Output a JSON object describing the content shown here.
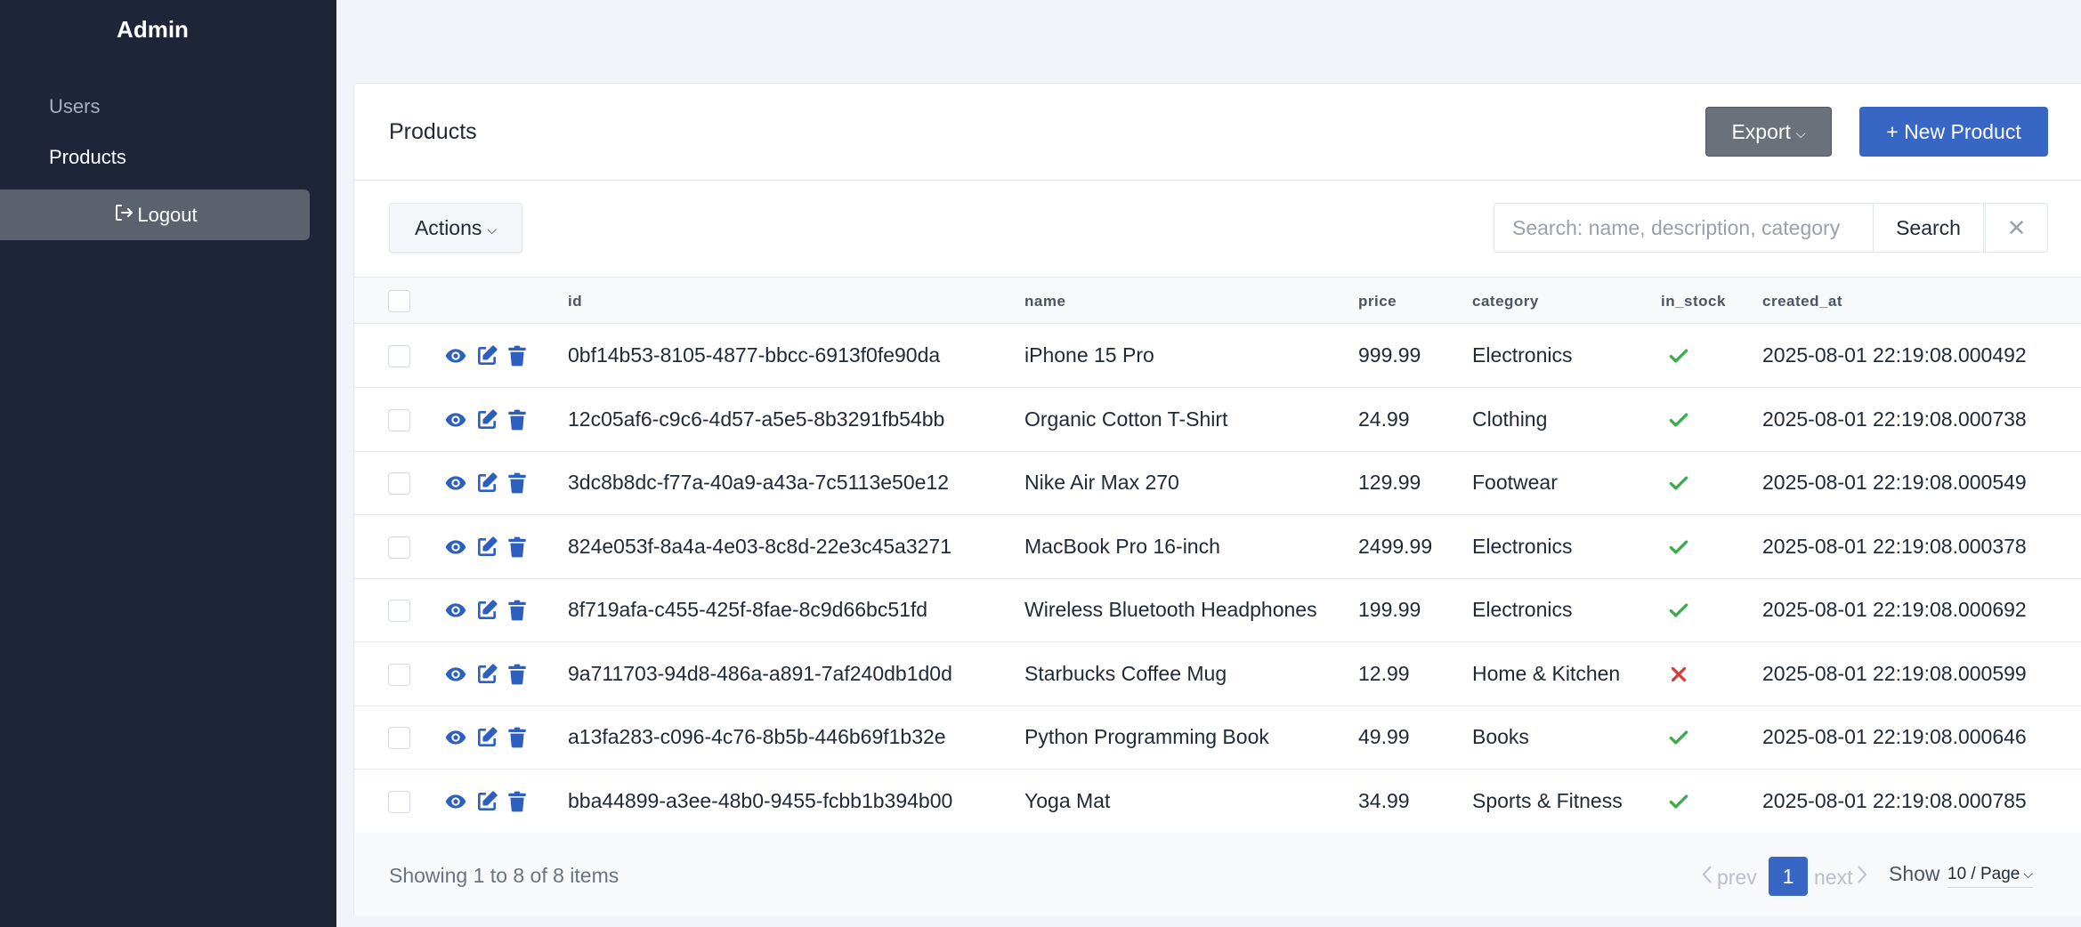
{
  "sidebar": {
    "brand": "Admin",
    "items": [
      {
        "label": "Users"
      },
      {
        "label": "Products"
      }
    ],
    "logout": "Logout"
  },
  "page": {
    "title": "Products",
    "export_label": "Export",
    "new_label": "+ New Product",
    "actions_label": "Actions",
    "search_placeholder": "Search: name, description, category",
    "search_label": "Search",
    "clear_label": "✕"
  },
  "table": {
    "columns": [
      "id",
      "name",
      "price",
      "category",
      "in_stock",
      "created_at"
    ],
    "rows": [
      {
        "id": "0bf14b53-8105-4877-bbcc-6913f0fe90da",
        "name": "iPhone 15 Pro",
        "price": "999.99",
        "category": "Electronics",
        "in_stock": true,
        "created_at": "2025-08-01 22:19:08.000492"
      },
      {
        "id": "12c05af6-c9c6-4d57-a5e5-8b3291fb54bb",
        "name": "Organic Cotton T-Shirt",
        "price": "24.99",
        "category": "Clothing",
        "in_stock": true,
        "created_at": "2025-08-01 22:19:08.000738"
      },
      {
        "id": "3dc8b8dc-f77a-40a9-a43a-7c5113e50e12",
        "name": "Nike Air Max 270",
        "price": "129.99",
        "category": "Footwear",
        "in_stock": true,
        "created_at": "2025-08-01 22:19:08.000549"
      },
      {
        "id": "824e053f-8a4a-4e03-8c8d-22e3c45a3271",
        "name": "MacBook Pro 16-inch",
        "price": "2499.99",
        "category": "Electronics",
        "in_stock": true,
        "created_at": "2025-08-01 22:19:08.000378"
      },
      {
        "id": "8f719afa-c455-425f-8fae-8c9d66bc51fd",
        "name": "Wireless Bluetooth Headphones",
        "price": "199.99",
        "category": "Electronics",
        "in_stock": true,
        "created_at": "2025-08-01 22:19:08.000692"
      },
      {
        "id": "9a711703-94d8-486a-a891-7af240db1d0d",
        "name": "Starbucks Coffee Mug",
        "price": "12.99",
        "category": "Home & Kitchen",
        "in_stock": false,
        "created_at": "2025-08-01 22:19:08.000599"
      },
      {
        "id": "a13fa283-c096-4c76-8b5b-446b69f1b32e",
        "name": "Python Programming Book",
        "price": "49.99",
        "category": "Books",
        "in_stock": true,
        "created_at": "2025-08-01 22:19:08.000646"
      },
      {
        "id": "bba44899-a3ee-48b0-9455-fcbb1b394b00",
        "name": "Yoga Mat",
        "price": "34.99",
        "category": "Sports & Fitness",
        "in_stock": true,
        "created_at": "2025-08-01 22:19:08.000785"
      }
    ]
  },
  "footer": {
    "showing": "Showing 1 to 8 of 8 items",
    "prev": "prev",
    "current_page": "1",
    "next": "next",
    "show": "Show",
    "page_size": "10 / Page"
  },
  "colors": {
    "sidebar_bg": "#1e2538",
    "accent": "#3766c4",
    "check": "#3cab4d",
    "cross": "#d63b3b"
  },
  "icons": [
    "logout-icon",
    "eye-icon",
    "edit-icon",
    "trash-icon",
    "check-icon",
    "cross-icon",
    "chevron-left-icon",
    "chevron-right-icon",
    "chevron-down-icon"
  ]
}
